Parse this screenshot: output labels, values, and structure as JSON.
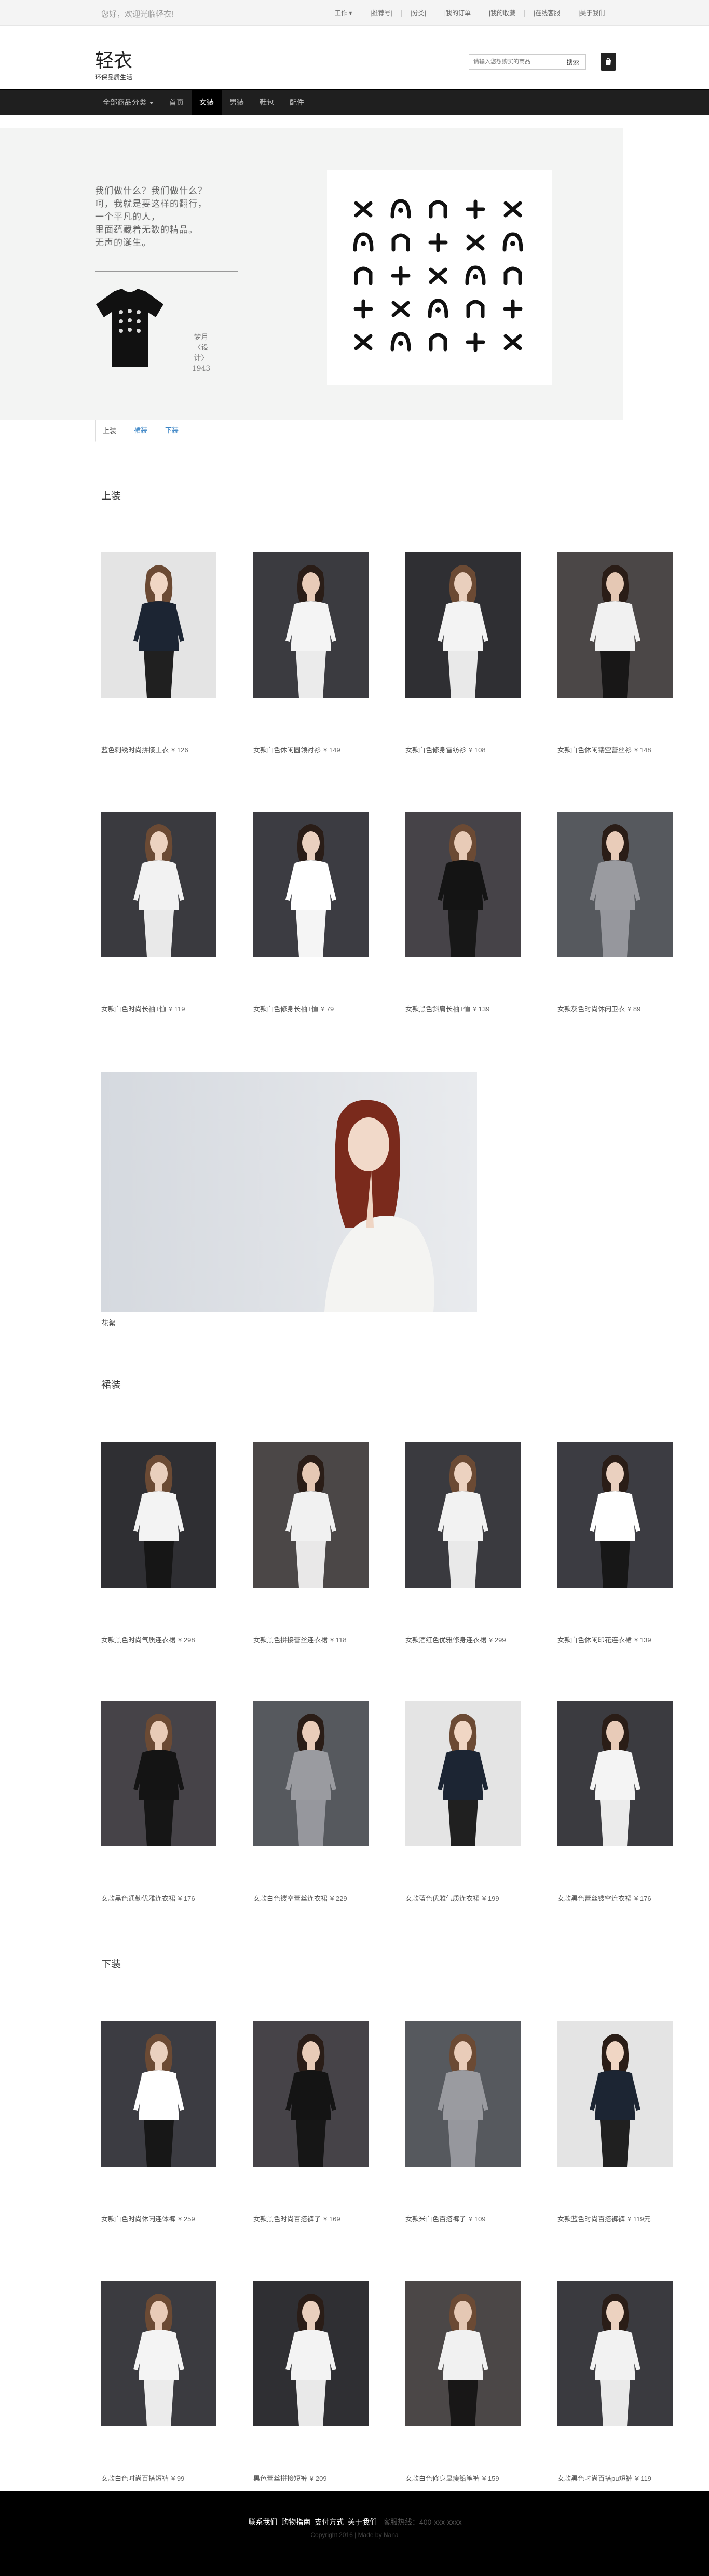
{
  "topbar": {
    "welcome": "您好，欢迎光临轻衣!",
    "links": [
      "工作 ▾",
      "|推荐号|",
      "|分类|",
      "|我的订单",
      "|我的收藏",
      "|在线客服",
      "|关于我们"
    ]
  },
  "header": {
    "brand": "轻衣",
    "tagline": "环保品质生活",
    "search_placeholder": "请输入您想购买的商品",
    "search_button": "搜索"
  },
  "nav": {
    "all_categories": "全部商品分类",
    "items": [
      "首页",
      "女装",
      "男装",
      "鞋包",
      "配件"
    ],
    "active_index": 1
  },
  "hero": {
    "poem": "我们做什么？我们做什么？\n呵，我就是要这样的翻行，\n一个平凡的人，\n里面蕴藏着无数的精品。\n无声的诞生。",
    "tee_caption": "梦月\n〈设计〉\n1943"
  },
  "tabs": [
    "上装",
    "裙装",
    "下装"
  ],
  "sections": {
    "tops": {
      "title": "上装",
      "products": [
        {
          "name": "蓝色刺绣时尚拼接上衣",
          "price": "¥ 126"
        },
        {
          "name": "女款白色休闲圆领衬衫",
          "price": "¥ 149"
        },
        {
          "name": "女款白色修身雪纺衫",
          "price": "¥ 108"
        },
        {
          "name": "女款白色休闲镂空蕾丝衫",
          "price": "¥ 148"
        },
        {
          "name": "女款白色时尚长袖T恤",
          "price": "¥ 119"
        },
        {
          "name": "女款白色修身长袖T恤",
          "price": "¥ 79"
        },
        {
          "name": "女款黑色斜肩长袖T恤",
          "price": "¥ 139"
        },
        {
          "name": "女款灰色时尚休闲卫衣",
          "price": "¥ 89"
        }
      ],
      "feature_caption": "花絮"
    },
    "dresses": {
      "title": "裙装",
      "products": [
        {
          "name": "女款黑色时尚气质连衣裙",
          "price": "¥ 298"
        },
        {
          "name": "女款黑色拼接蕾丝连衣裙",
          "price": "¥ 118"
        },
        {
          "name": "女款酒红色优雅修身连衣裙",
          "price": "¥ 299"
        },
        {
          "name": "女款白色休闲印花连衣裙",
          "price": "¥ 139"
        },
        {
          "name": "女款黑色通勤优雅连衣裙",
          "price": "¥ 176"
        },
        {
          "name": "女款白色镂空蕾丝连衣裙",
          "price": "¥ 229"
        },
        {
          "name": "女款蓝色优雅气质连衣裙",
          "price": "¥ 199"
        },
        {
          "name": "女款黑色蕾丝镂空连衣裙",
          "price": "¥ 176"
        }
      ]
    },
    "bottoms": {
      "title": "下装",
      "products": [
        {
          "name": "女款白色时尚休闲连体裤",
          "price": "¥ 259"
        },
        {
          "name": "女款黑色时尚百搭裤子",
          "price": "¥ 169"
        },
        {
          "name": "女款米白色百搭裤子",
          "price": "¥ 109"
        },
        {
          "name": "女款蓝色时尚百搭裤裤",
          "price": "¥ 119元"
        },
        {
          "name": "女款白色时尚百搭短裤",
          "price": "¥ 99"
        },
        {
          "name": "黑色蕾丝拼接短裤",
          "price": "¥ 209"
        },
        {
          "name": "女款白色修身显瘦铅笔裤",
          "price": "¥ 159"
        },
        {
          "name": "女款黑色时尚百搭pu短裤",
          "price": "¥ 119"
        }
      ]
    }
  },
  "footer": {
    "links": [
      "联系我们",
      "购物指南",
      "支付方式",
      "关于我们"
    ],
    "phone": "客服热线：400-xxx-xxxx",
    "copyright": "Copyright 2016 | Made by Nana"
  },
  "colors": {
    "nav_bg": "#1f1f1f",
    "hero_bg": "#f3f4f3",
    "link_blue": "#3a84c5",
    "footer_bg": "#000000"
  }
}
